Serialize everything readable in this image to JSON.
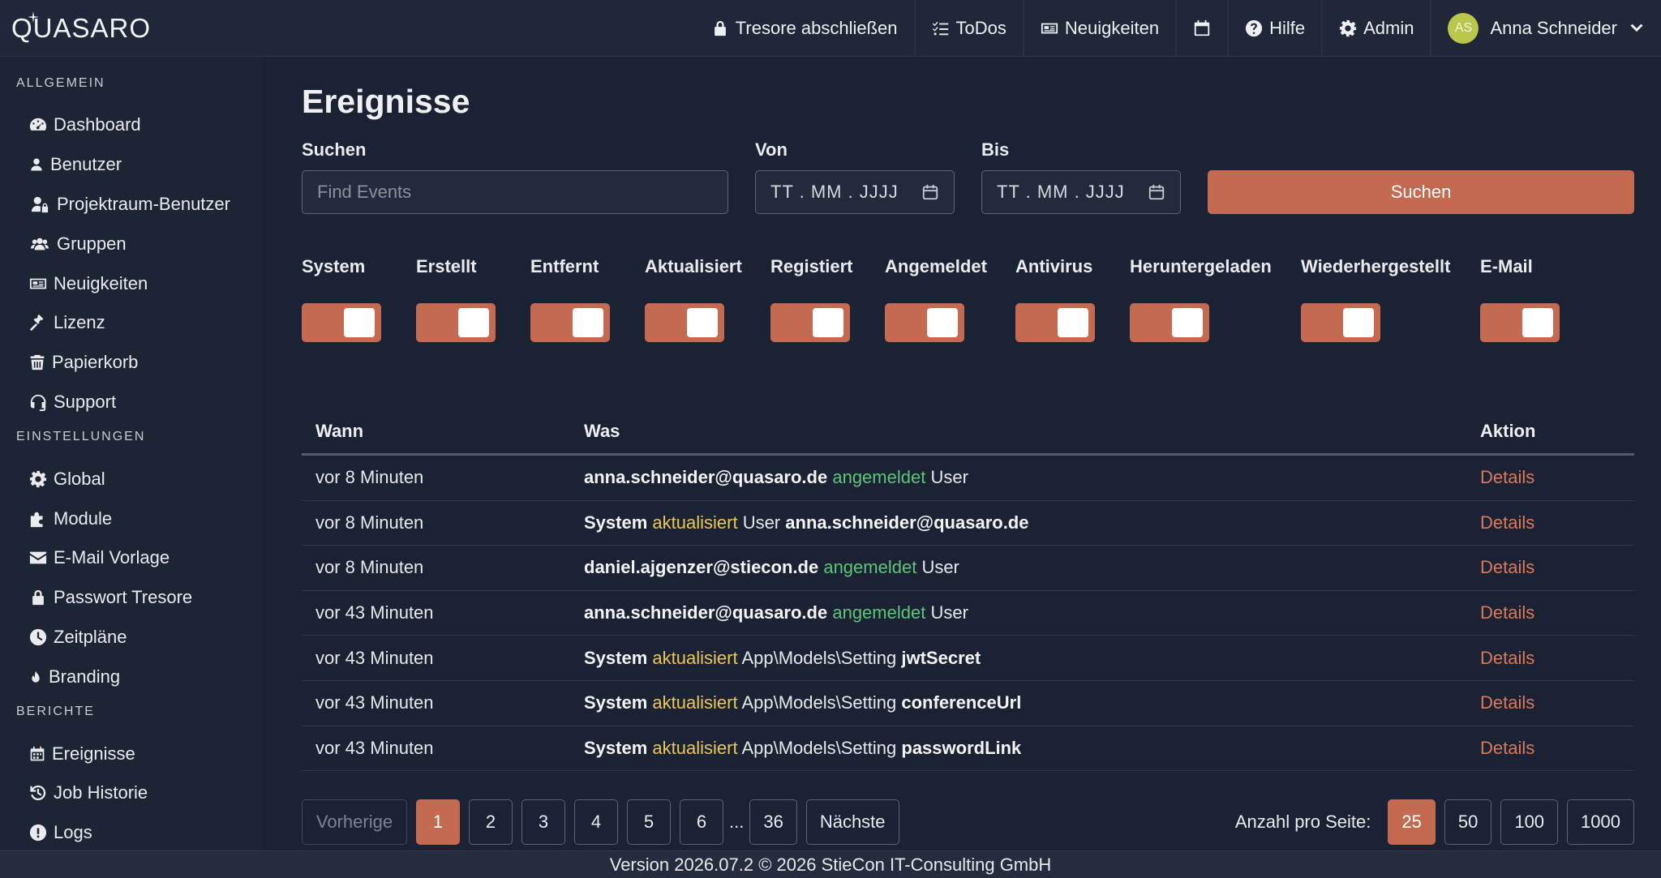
{
  "app": {
    "logo_text": "QUASARO"
  },
  "nav": {
    "items": [
      {
        "label": "Tresore abschließen",
        "icon": "lock-icon"
      },
      {
        "label": "ToDos",
        "icon": "checklist-icon"
      },
      {
        "label": "Neuigkeiten",
        "icon": "newspaper-icon"
      },
      {
        "label": "",
        "icon": "calendar-icon"
      },
      {
        "label": "Hilfe",
        "icon": "help-icon"
      },
      {
        "label": "Admin",
        "icon": "gear-icon"
      }
    ],
    "user": {
      "initials": "AS",
      "name": "Anna Schneider"
    }
  },
  "sidebar": {
    "sections": [
      {
        "title": "ALLGEMEIN",
        "items": [
          {
            "label": "Dashboard",
            "icon": "gauge-icon"
          },
          {
            "label": "Benutzer",
            "icon": "user-icon"
          },
          {
            "label": "Projektraum-Benutzer",
            "icon": "user-lock-icon"
          },
          {
            "label": "Gruppen",
            "icon": "users-icon"
          },
          {
            "label": "Neuigkeiten",
            "icon": "newspaper-icon"
          },
          {
            "label": "Lizenz",
            "icon": "gavel-icon"
          },
          {
            "label": "Papierkorb",
            "icon": "trash-icon"
          },
          {
            "label": "Support",
            "icon": "headset-icon"
          }
        ]
      },
      {
        "title": "EINSTELLUNGEN",
        "items": [
          {
            "label": "Global",
            "icon": "gear-icon"
          },
          {
            "label": "Module",
            "icon": "puzzle-icon"
          },
          {
            "label": "E-Mail Vorlage",
            "icon": "envelope-icon"
          },
          {
            "label": "Passwort Tresore",
            "icon": "lock-icon"
          },
          {
            "label": "Zeitpläne",
            "icon": "clock-icon"
          },
          {
            "label": "Branding",
            "icon": "flame-icon"
          }
        ]
      },
      {
        "title": "BERICHTE",
        "items": [
          {
            "label": "Ereignisse",
            "icon": "calendar-grid-icon"
          },
          {
            "label": "Job Historie",
            "icon": "history-icon"
          },
          {
            "label": "Logs",
            "icon": "exclamation-icon"
          }
        ]
      }
    ]
  },
  "main": {
    "title": "Ereignisse",
    "search": {
      "label": "Suchen",
      "placeholder": "Find Events",
      "value": ""
    },
    "from": {
      "label": "Von",
      "placeholder": "TT . MM . JJJJ"
    },
    "to": {
      "label": "Bis",
      "placeholder": "TT . MM . JJJJ"
    },
    "search_button": "Suchen",
    "filters": [
      {
        "label": "System",
        "on": true
      },
      {
        "label": "Erstellt",
        "on": true
      },
      {
        "label": "Entfernt",
        "on": true
      },
      {
        "label": "Aktualisiert",
        "on": true
      },
      {
        "label": "Registiert",
        "on": true
      },
      {
        "label": "Angemeldet",
        "on": true
      },
      {
        "label": "Antivirus",
        "on": true
      },
      {
        "label": "Heruntergeladen",
        "on": true
      },
      {
        "label": "Wiederhergestellt",
        "on": true
      },
      {
        "label": "E-Mail",
        "on": true
      }
    ],
    "table": {
      "headers": {
        "when": "Wann",
        "what": "Was",
        "action": "Aktion"
      },
      "rows": [
        {
          "when": "vor 8 Minuten",
          "actor": "anna.schneider@quasaro.de",
          "verb": "angemeldet",
          "verb_color": "green",
          "object": "User",
          "target": "",
          "action": "Details"
        },
        {
          "when": "vor 8 Minuten",
          "actor": "System",
          "verb": "aktualisiert",
          "verb_color": "yellow",
          "object": "User",
          "target": "anna.schneider@quasaro.de",
          "action": "Details"
        },
        {
          "when": "vor 8 Minuten",
          "actor": "daniel.ajgenzer@stiecon.de",
          "verb": "angemeldet",
          "verb_color": "green",
          "object": "User",
          "target": "",
          "action": "Details"
        },
        {
          "when": "vor 43 Minuten",
          "actor": "anna.schneider@quasaro.de",
          "verb": "angemeldet",
          "verb_color": "green",
          "object": "User",
          "target": "",
          "action": "Details"
        },
        {
          "when": "vor 43 Minuten",
          "actor": "System",
          "verb": "aktualisiert",
          "verb_color": "yellow",
          "object": "App\\Models\\Setting",
          "target": "jwtSecret",
          "action": "Details"
        },
        {
          "when": "vor 43 Minuten",
          "actor": "System",
          "verb": "aktualisiert",
          "verb_color": "yellow",
          "object": "App\\Models\\Setting",
          "target": "conferenceUrl",
          "action": "Details"
        },
        {
          "when": "vor 43 Minuten",
          "actor": "System",
          "verb": "aktualisiert",
          "verb_color": "yellow",
          "object": "App\\Models\\Setting",
          "target": "passwordLink",
          "action": "Details"
        }
      ]
    },
    "pagination": {
      "prev": "Vorherige",
      "pages": [
        "1",
        "2",
        "3",
        "4",
        "5",
        "6"
      ],
      "current": "1",
      "ellipsis": "...",
      "last": "36",
      "next": "Nächste",
      "per_page_label": "Anzahl pro Seite:",
      "per_page_options": [
        "25",
        "50",
        "100",
        "1000"
      ],
      "per_page_selected": "25"
    }
  },
  "footer": {
    "text": "Version 2026.07.2 © 2026 StieCon IT-Consulting GmbH"
  },
  "colors": {
    "accent": "#c46a51",
    "link": "#d97a5d",
    "verb_green": "#5fc47b",
    "verb_yellow": "#e9c75a",
    "background": "#1b2233"
  }
}
